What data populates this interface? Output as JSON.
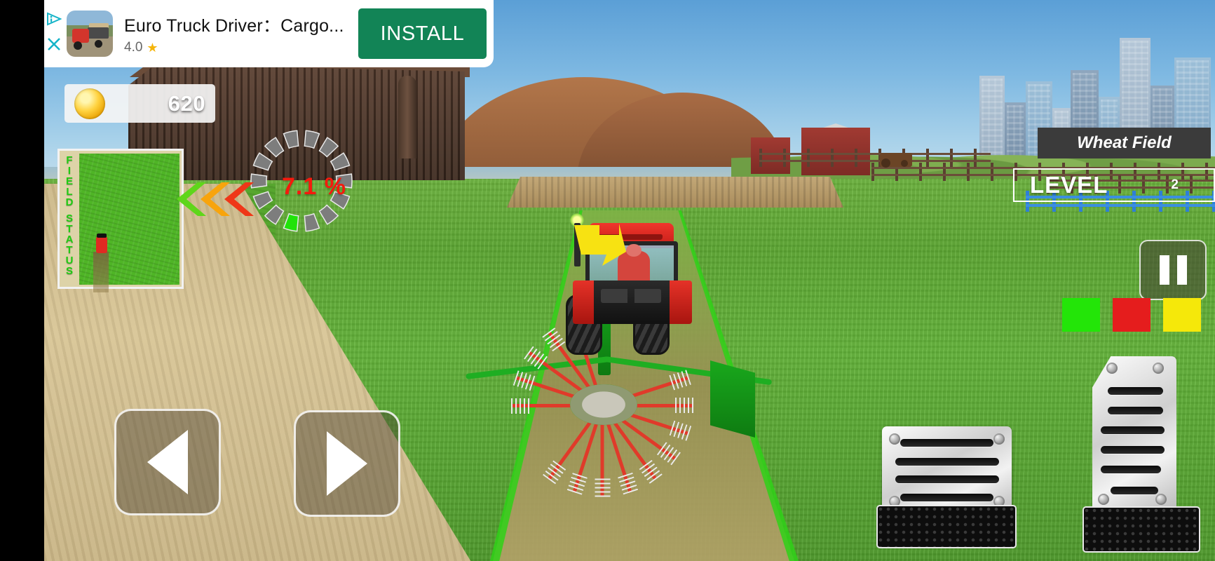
{
  "ad": {
    "app_title": "Euro Truck Driver：Cargo...",
    "rating": "4.0",
    "star_icon": "★",
    "install_label": "INSTALL",
    "adchoices_icon": "adchoices-icon",
    "close_icon": "close-icon",
    "thumb_icon": "app-thumbnail-truck"
  },
  "hud": {
    "coins": {
      "value": "620",
      "icon": "coin-icon"
    },
    "minimap": {
      "label": "FIELD STATUS"
    },
    "progress": {
      "value": "7.1 %",
      "percent": 7.1,
      "color": "#f51a0d",
      "segment_filled_color": "#21e30a",
      "segment_empty_color": "#7d7d7d"
    },
    "field_name": "Wheat Field",
    "level": {
      "label": "LEVEL",
      "value": "2"
    },
    "pause_icon": "pause-icon",
    "status_squares": [
      {
        "name": "status-green",
        "color": "#23e508"
      },
      {
        "name": "status-red",
        "color": "#e51d1d"
      },
      {
        "name": "status-yellow",
        "color": "#f5e80a"
      }
    ],
    "chevrons": [
      {
        "name": "chevron-green",
        "color": "#5fd61a"
      },
      {
        "name": "chevron-orange",
        "color": "#f8a40c"
      },
      {
        "name": "chevron-red",
        "color": "#ef3718"
      }
    ],
    "direction_arrow": {
      "name": "direction-arrow-icon",
      "color": "#f7e212"
    }
  },
  "controls": {
    "steer_left": "steer-left-button",
    "steer_right": "steer-right-button",
    "brake_pedal": "brake-pedal",
    "accelerator_pedal": "accelerator-pedal"
  },
  "scene": {
    "vehicle": "red-tractor",
    "implement": "green-rotary-rake",
    "sky_color": "#7fb9e2",
    "grass_color": "#5da733",
    "road_color": "#d8c596"
  }
}
